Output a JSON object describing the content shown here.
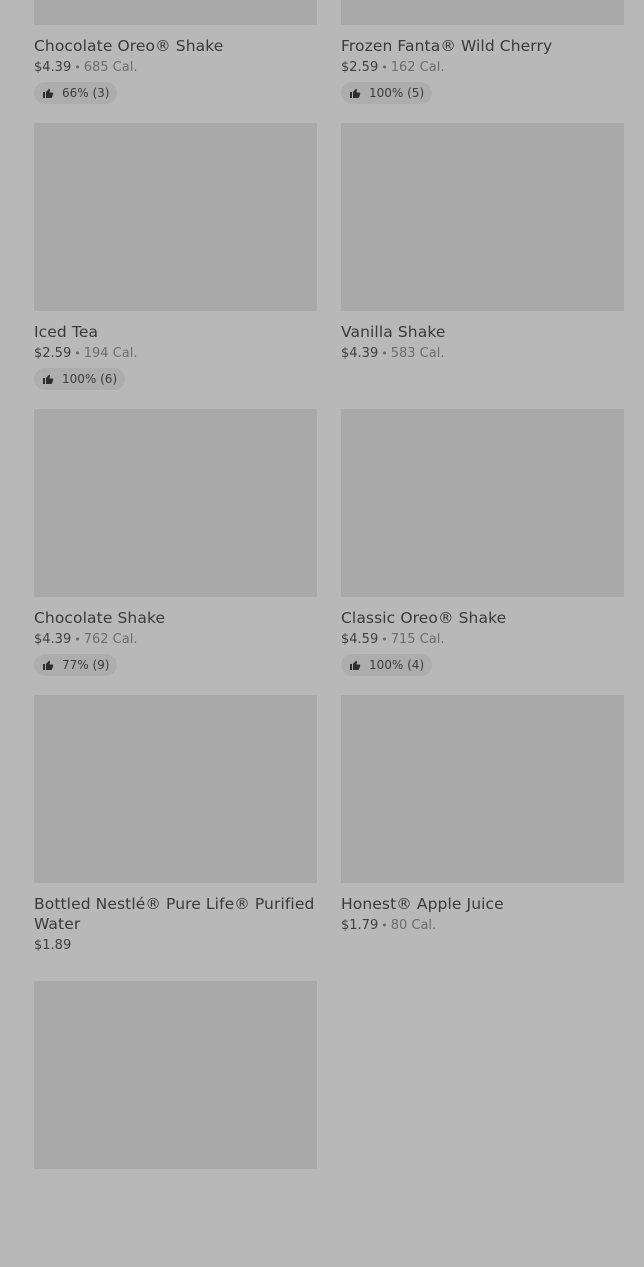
{
  "items": [
    {
      "name": "Chocolate Oreo® Shake",
      "price": "$4.39",
      "dot": "•",
      "calories": "685 Cal.",
      "rating": "66% (3)"
    },
    {
      "name": "Frozen Fanta® Wild Cherry",
      "price": "$2.59",
      "dot": "•",
      "calories": "162 Cal.",
      "rating": "100% (5)"
    },
    {
      "name": "Iced Tea",
      "price": "$2.59",
      "dot": "•",
      "calories": "194 Cal.",
      "rating": "100% (6)"
    },
    {
      "name": "Vanilla Shake",
      "price": "$4.39",
      "dot": "•",
      "calories": "583 Cal.",
      "rating": ""
    },
    {
      "name": "Chocolate Shake",
      "price": "$4.39",
      "dot": "•",
      "calories": "762 Cal.",
      "rating": "77% (9)"
    },
    {
      "name": "Classic Oreo® Shake",
      "price": "$4.59",
      "dot": "•",
      "calories": "715 Cal.",
      "rating": "100% (4)"
    },
    {
      "name": "Bottled Nestlé® Pure Life® Purified Water",
      "price": "$1.89",
      "dot": "",
      "calories": "",
      "rating": ""
    },
    {
      "name": "Honest® Apple Juice",
      "price": "$1.79",
      "dot": "•",
      "calories": "80 Cal.",
      "rating": ""
    },
    {
      "name": "",
      "price": "",
      "dot": "",
      "calories": "",
      "rating": ""
    }
  ],
  "icons": {
    "rating": "thumbs-up-icon"
  }
}
